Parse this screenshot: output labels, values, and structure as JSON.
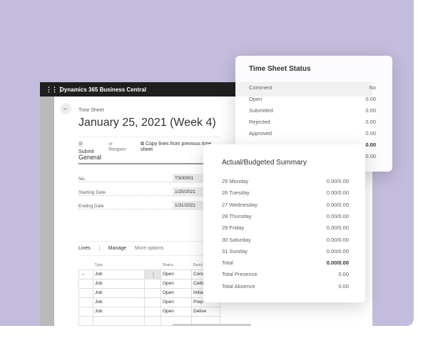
{
  "app": {
    "title": "Dynamics 365 Business Central"
  },
  "page": {
    "breadcrumb": "Time Sheet",
    "title": "January 25, 2021 (Week 4)"
  },
  "actions": {
    "submit": "Submit",
    "reopen": "Reopen",
    "copy": "Copy lines from previous time sheet"
  },
  "general": {
    "heading": "General",
    "fields": [
      {
        "label": "No.",
        "value": "TS00001"
      },
      {
        "label": "Starting Date",
        "value": "1/25/2021"
      },
      {
        "label": "Ending Date",
        "value": "1/31/2021"
      }
    ]
  },
  "lines": {
    "tab": "Lines",
    "manage": "Manage",
    "more": "More options",
    "columns": [
      "Type",
      "Status",
      "Descr"
    ],
    "rows": [
      {
        "type": "Job",
        "status": "Open",
        "desc": "Cons"
      },
      {
        "type": "Job",
        "status": "Open",
        "desc": "Ceilin"
      },
      {
        "type": "Job",
        "status": "Open",
        "desc": "Initial"
      },
      {
        "type": "Job",
        "status": "Open",
        "desc": "Prep"
      },
      {
        "type": "Job",
        "status": "Open",
        "desc": "Delive"
      }
    ]
  },
  "status_card": {
    "title": "Time Sheet Status",
    "rows": [
      {
        "label": "Comment",
        "value": "No"
      },
      {
        "label": "Open",
        "value": "0.00"
      },
      {
        "label": "Submitted",
        "value": "0.00"
      },
      {
        "label": "Rejected",
        "value": "0.00"
      },
      {
        "label": "Approved",
        "value": "0.00"
      },
      {
        "label": "",
        "value": "0.00"
      },
      {
        "label": "",
        "value": "0.00"
      }
    ]
  },
  "summary_card": {
    "title": "Actual/Budgeted Summary",
    "rows": [
      {
        "label": "25 Monday",
        "value": "0.00/0.00"
      },
      {
        "label": "26 Tuesday",
        "value": "0.00/0.00"
      },
      {
        "label": "27 Wednesday",
        "value": "0.00/0.00"
      },
      {
        "label": "28 Thursday",
        "value": "0.00/0.00"
      },
      {
        "label": "29 Friday",
        "value": "0.00/0.00"
      },
      {
        "label": "30 Saturday",
        "value": "0.00/0.00"
      },
      {
        "label": "31 Sunday",
        "value": "0.00/0.00"
      },
      {
        "label": "Total",
        "value": "0.00/0.00"
      },
      {
        "label": "Total Presence",
        "value": "0.00"
      },
      {
        "label": "Total Absence",
        "value": "0.00"
      }
    ]
  },
  "colors": {
    "background": "#c4bcdc",
    "titlebar": "#1f1f1f"
  }
}
